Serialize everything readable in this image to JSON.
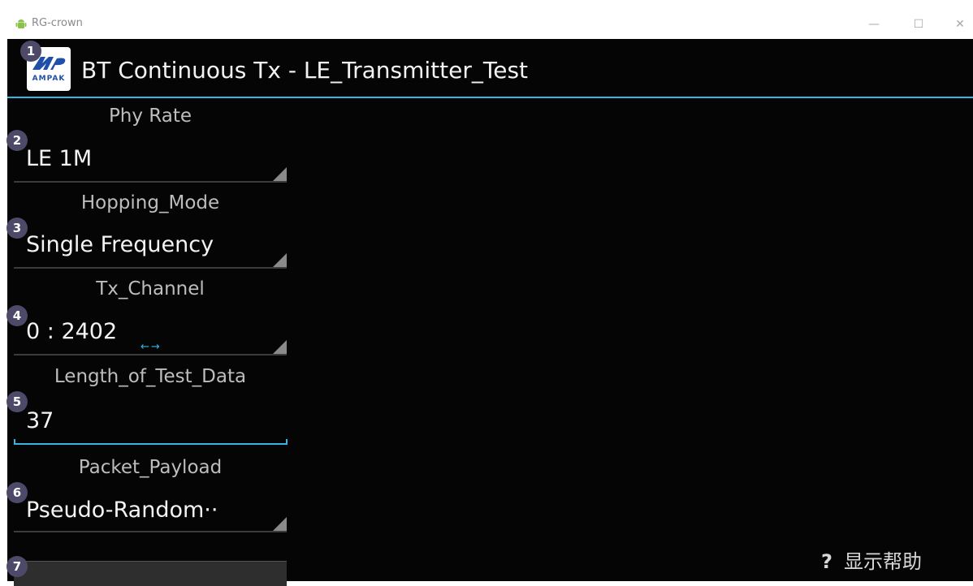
{
  "window": {
    "title": "RG-crown",
    "controls": {
      "minimize": "—",
      "maximize": "☐",
      "close": "✕"
    }
  },
  "header": {
    "logo_text": "AMPAK",
    "title": "BT Continuous Tx - LE_Transmitter_Test"
  },
  "badges": [
    "1",
    "2",
    "3",
    "4",
    "5",
    "6",
    "7"
  ],
  "fields": {
    "phy_rate": {
      "label": "Phy Rate",
      "value": "LE 1M"
    },
    "hopping_mode": {
      "label": "Hopping_Mode",
      "value": "Single Frequency"
    },
    "tx_channel": {
      "label": "Tx_Channel",
      "value": "0 : 2402",
      "arrows": "←→"
    },
    "length_of_test_data": {
      "label": "Length_of_Test_Data",
      "value": "37"
    },
    "packet_payload": {
      "label": "Packet_Payload",
      "value": "Pseudo-Random··"
    }
  },
  "help": {
    "icon": "?",
    "label": "显示帮助"
  },
  "colors": {
    "accent": "#33b5e5",
    "background": "#050505",
    "badge": "#4d4968"
  }
}
